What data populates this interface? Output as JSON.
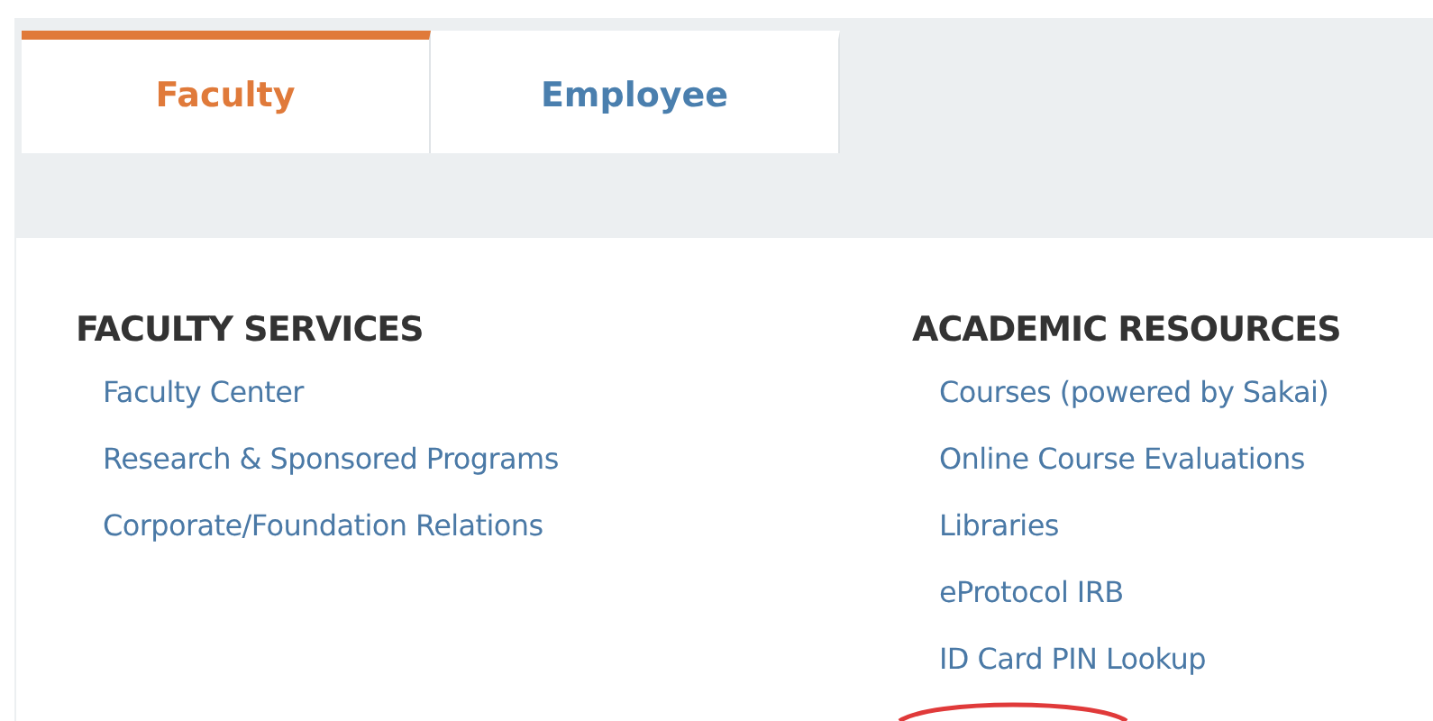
{
  "tabs": [
    {
      "label": "Faculty",
      "selected": true
    },
    {
      "label": "Employee",
      "selected": false
    }
  ],
  "columns": [
    {
      "heading": "FACULTY SERVICES",
      "links": [
        "Faculty Center",
        "Research & Sponsored Programs",
        "Corporate/Foundation Relations"
      ]
    },
    {
      "heading": "ACADEMIC RESOURCES",
      "links": [
        "Courses (powered by Sakai)",
        "Online Course Evaluations",
        "Libraries",
        "eProtocol IRB",
        "ID Card PIN Lookup"
      ]
    }
  ]
}
